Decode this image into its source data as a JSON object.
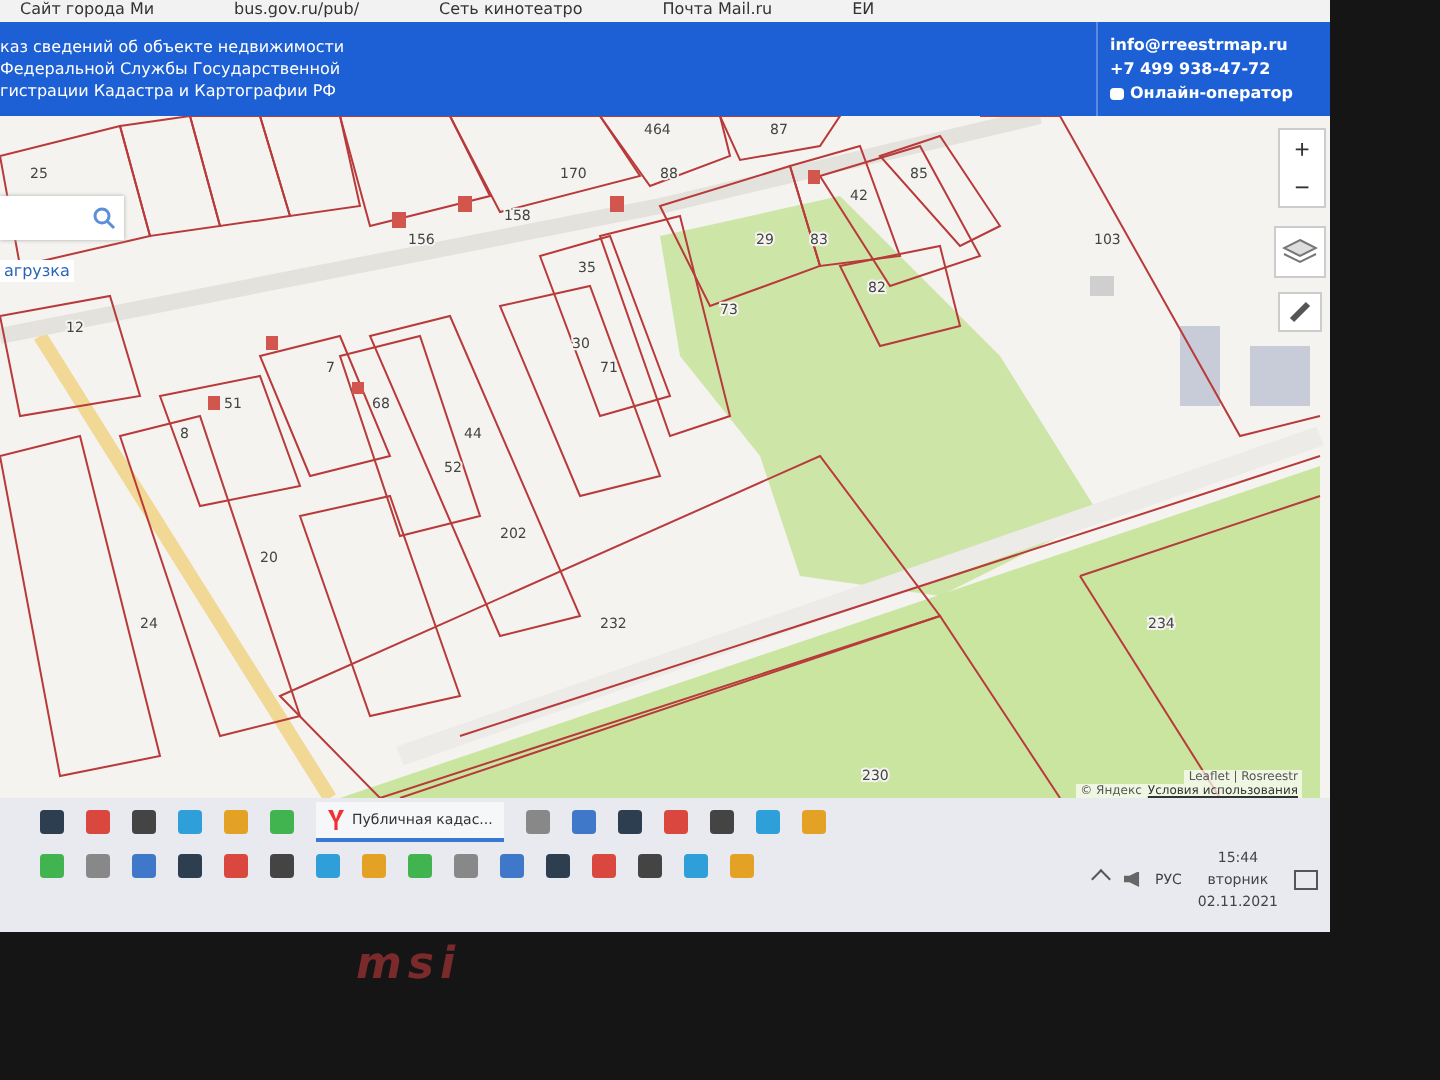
{
  "browser": {
    "bookmarks": [
      {
        "label": "Сайт города Ми"
      },
      {
        "label": "bus.gov.ru/pub/"
      },
      {
        "label": "Сеть кинотеатро"
      },
      {
        "label": "Почта Mail.ru"
      },
      {
        "label": "ЕИ"
      }
    ]
  },
  "header": {
    "lines": [
      "каз сведений об объекте недвижимости",
      "Федеральной Службы Государственной",
      "гистрации Кадастра и Картографии РФ"
    ],
    "email": "info@rreestrmap.ru",
    "phone": "+7 499 938-47-72",
    "chat": "Онлайн-оператор"
  },
  "map": {
    "parcel_labels": [
      "464",
      "87",
      "25",
      "170",
      "88",
      "85",
      "42",
      "158",
      "156",
      "29",
      "83",
      "103",
      "35",
      "82",
      "73",
      "12",
      "30",
      "7",
      "71",
      "51",
      "68",
      "8",
      "44",
      "52",
      "202",
      "20",
      "24",
      "232",
      "234",
      "230"
    ],
    "link": "агрузка",
    "zoom_in": "+",
    "zoom_out": "−",
    "attribution": "Leaflet | Rosreestr",
    "copyright": "© Яндекс",
    "terms": "Условия использования"
  },
  "taskbar": {
    "active_task": {
      "label": "Публичная кадас...",
      "selected": true
    },
    "language": "РУС",
    "time": "15:44",
    "weekday": "вторник",
    "date": "02.11.2021"
  },
  "laptop": {
    "brand": "msi"
  }
}
